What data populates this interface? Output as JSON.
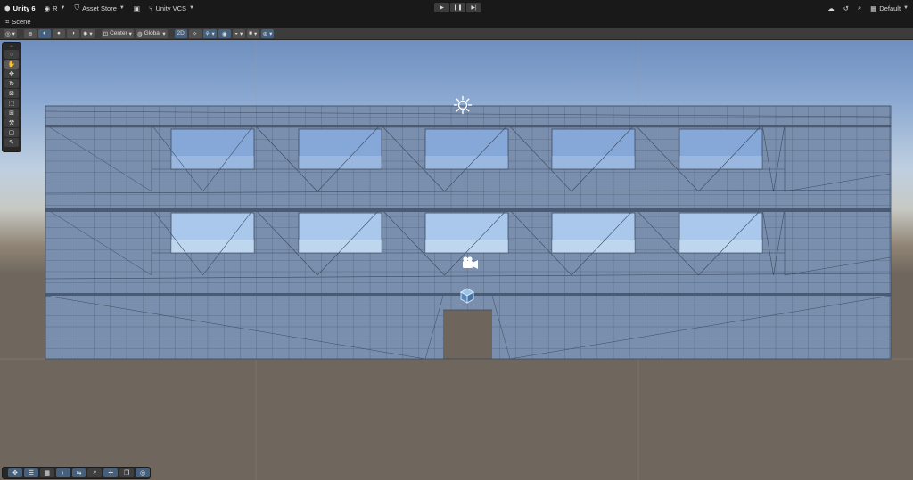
{
  "topbar": {
    "app_name": "Unity 6",
    "account_label": "R",
    "asset_store_label": "Asset Store",
    "vcs_label": "Unity VCS",
    "layout_label": "Default",
    "icons": [
      "unity-logo-icon",
      "account-icon",
      "asset-store-icon",
      "package-icon",
      "vcs-icon",
      "play-icon",
      "pause-icon",
      "step-icon",
      "cloud-icon",
      "history-icon",
      "search-icon",
      "layout-icon"
    ]
  },
  "tabs": [
    {
      "label": "Scene",
      "icon": "scene-icon"
    }
  ],
  "scene_toolbar": {
    "pivot_label": "Center",
    "space_label": "Global",
    "mode_2d_label": "2D"
  },
  "scene": {
    "colors": {
      "building": "#7a8fae",
      "grid_line": "#3c4a60",
      "ground": "#6f665e",
      "door": "#6e665c"
    },
    "gizmos": [
      "sun-light-gizmo-icon",
      "camera-gizmo-icon",
      "game-object-gizmo-icon"
    ]
  }
}
